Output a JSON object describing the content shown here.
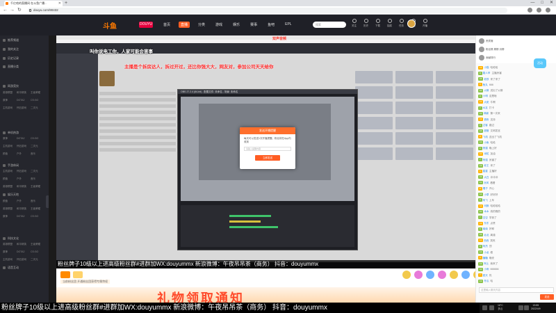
{
  "browser": {
    "tab_title": "千亿哈的直播间 在斗鱼广播...",
    "new_tab": "+",
    "url": "douyu.com/90432",
    "win_min": "—",
    "win_max": "□",
    "win_close": "✕"
  },
  "site": {
    "logo": "斗鱼",
    "logo_badge": "DOUYU",
    "nav": [
      "首页",
      "直播",
      "分类",
      "游戏",
      "娱乐",
      "赛事",
      "鱼吧",
      "EPL"
    ],
    "search_placeholder": "搜索",
    "header_icons": [
      "关注",
      "历史",
      "下载",
      "抽奖",
      "任务",
      "消息",
      "开播"
    ],
    "live_tag": "双声音频"
  },
  "sidebar": {
    "sections": [
      "推荐频道",
      "我的关注",
      "历史记录",
      "直播分类",
      "网游竞技",
      "单机热游",
      "手游休闲",
      "娱乐天地",
      "科技文化",
      "语音互动"
    ],
    "grid_items": [
      "英雄联盟",
      "和平精英",
      "王者荣耀",
      "原神",
      "DOTA2",
      "CS:GO",
      "主机游戏",
      "怀旧游戏",
      "二次元",
      "颜值",
      "户外",
      "音乐"
    ],
    "bottom_buttons": [
      "下载客户端",
      "开播"
    ]
  },
  "stream": {
    "overlay_title": "叫你说电工你，人家可能会害事",
    "overlay_marquee": "主播是个拆房达人，拆过开过，还比你强大大，网友对，参加公司天天给你",
    "dialog_title": "发送开播提醒",
    "dialog_body": "每天可以发送1次开播提醒，粉丝将在App内收到",
    "dialog_input": "请输入提醒内容",
    "dialog_button": "立即发送",
    "recursive_title": "OBS 27.2.4 (64-bit) - 配置文件: 未命名 - 场景: 未命名",
    "ticker": "粉丝牌子10级以上进高级粉丝群#进群加WX:douyummx 新浪微博：午夜吊吊茶（商务）     抖音：douyummx",
    "sub_text": "当前粉丝团 开通粉丝团获得专属特权",
    "banner": "礼物领取通知"
  },
  "caption": "粉丝牌子10级以上进高级粉丝群#进群加WX:douyummx 新浪微博：午夜吊吊茶（商务）     抖音：douyummx",
  "chat": {
    "top_rows": [
      "贵宾席",
      "粉丝榜 周榜 月榜",
      "贡献排行"
    ],
    "messages": [
      {
        "badge": "12",
        "user": "小猫",
        "text": "哈哈哈"
      },
      {
        "badge": "8",
        "user": "路人甲",
        "text": "主播厉害"
      },
      {
        "badge": "15",
        "user": "老铁",
        "text": "来了来了"
      },
      {
        "badge": "6",
        "user": "鱼丸",
        "text": "666"
      },
      {
        "badge": "10",
        "user": "火箭",
        "text": "送出了火箭"
      },
      {
        "badge": "9",
        "user": "小明",
        "text": "这是啥"
      },
      {
        "badge": "14",
        "user": "大佬",
        "text": "牛啊"
      },
      {
        "badge": "7",
        "user": "水友",
        "text": "打卡"
      },
      {
        "badge": "11",
        "user": "萌新",
        "text": "第一次来"
      },
      {
        "badge": "13",
        "user": "铁粉",
        "text": "支持"
      },
      {
        "badge": "5",
        "user": "过客",
        "text": "路过"
      },
      {
        "badge": "16",
        "user": "超管",
        "text": "文明发言"
      },
      {
        "badge": "8",
        "user": "飞机",
        "text": "送出了飞机"
      },
      {
        "badge": "12",
        "user": "小鱼",
        "text": "哈哈"
      },
      {
        "badge": "9",
        "user": "夜猫",
        "text": "晚上好"
      },
      {
        "badge": "10",
        "user": "米粒",
        "text": "加油"
      },
      {
        "badge": "7",
        "user": "阿强",
        "text": "厉害了"
      },
      {
        "badge": "13",
        "user": "老王",
        "text": "来了"
      },
      {
        "badge": "6",
        "user": "星星",
        "text": "主播好"
      },
      {
        "badge": "15",
        "user": "大白",
        "text": "冲冲冲"
      },
      {
        "badge": "11",
        "user": "凉风",
        "text": "看看"
      },
      {
        "badge": "8",
        "user": "橘子",
        "text": "开心"
      },
      {
        "badge": "14",
        "user": "小草",
        "text": "好好好"
      },
      {
        "badge": "9",
        "user": "阿飞",
        "text": "上车"
      },
      {
        "badge": "12",
        "user": "河豚",
        "text": "哈哈哈哈"
      },
      {
        "badge": "10",
        "user": "木木",
        "text": "真的假的"
      },
      {
        "badge": "7",
        "user": "空空",
        "text": "学到了"
      },
      {
        "badge": "13",
        "user": "东东",
        "text": "点赞"
      },
      {
        "badge": "6",
        "user": "南南",
        "text": "好耶"
      },
      {
        "badge": "15",
        "user": "北北",
        "text": "离谱"
      },
      {
        "badge": "11",
        "user": "西西",
        "text": "笑死"
      },
      {
        "badge": "8",
        "user": "阿杰",
        "text": "顶"
      },
      {
        "badge": "14",
        "user": "小龙",
        "text": "稳"
      },
      {
        "badge": "9",
        "user": "糖糖",
        "text": "晚安"
      },
      {
        "badge": "12",
        "user": "阿土",
        "text": "我来了"
      },
      {
        "badge": "10",
        "user": "小雨",
        "text": "666666"
      },
      {
        "badge": "7",
        "user": "夏天",
        "text": "热"
      },
      {
        "badge": "13",
        "user": "冬瓜",
        "text": "哈"
      }
    ],
    "input_placeholder": "这里输入聊天内容",
    "send_label": "发送"
  },
  "float_badge": "活动",
  "taskbar": {
    "temp": "16°C",
    "weather": "多云",
    "time": "13:55",
    "date": "2022/4/9"
  },
  "colors": {
    "brand": "#ff5d23",
    "marquee": "#ff2d2d",
    "chat_link": "#2b8be6"
  }
}
